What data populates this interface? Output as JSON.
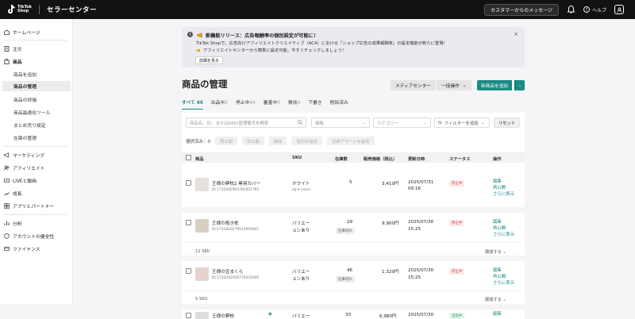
{
  "topbar": {
    "logo_line1": "TikTok",
    "logo_line2": "Shop",
    "title": "セラーセンター",
    "message_button": "カスタマーからのメッセージ",
    "help_label": "ヘルプ"
  },
  "sidebar": {
    "home": "ホームページ",
    "orders": "注文",
    "products": "商品",
    "products_sub": [
      "商品を追加",
      "商品の管理",
      "商品の評価",
      "商品最適化ツール",
      "まとめ売り設定",
      "在庫の管理"
    ],
    "marketing": "マーケティング",
    "affiliate": "アフィリエイト",
    "live": "LIVEと動画",
    "growth": "成長",
    "apps": "アプリとパートナー",
    "analytics": "分析",
    "account_health": "アカウントの健全性",
    "finance": "ファイナンス"
  },
  "banner": {
    "title": "新機能リリース：広告報酬率の個別設定が可能に！",
    "line1": "TikTok Shopで、広告向けアフィリエイトクリエイティブ（ACA）における「ショップ広告の成果報酬率」の設定機能が新たに登場！",
    "line2": "アフィリエイトセンターから簡単に設定可能。今すぐチェックしましょう！",
    "button": "詳細を見る",
    "close": "×"
  },
  "page": {
    "title": "商品の管理",
    "media_center": "メディアセンター",
    "bulk_action": "一括操作",
    "add_product": "新商品を追加"
  },
  "tabs": [
    {
      "label": "すべて",
      "count": "46"
    },
    {
      "label": "出品中",
      "count": "2"
    },
    {
      "label": "停止中",
      "count": "44"
    },
    {
      "label": "審査中",
      "count": "0"
    },
    {
      "label": "無効",
      "count": "0"
    },
    {
      "label": "下書き",
      "count": ""
    },
    {
      "label": "削除済み",
      "count": ""
    }
  ],
  "filters": {
    "search_placeholder": "商品名、ID、またはSKU/管理番号を検索",
    "price": "価格",
    "category": "カテゴリー",
    "add_filter": "フィルターを追加",
    "reset": "リセット"
  },
  "actions": {
    "selected": "選択済み：",
    "selected_count": "0",
    "buttons": [
      "再公開",
      "非公開",
      "削除",
      "割引を設定",
      "在庫アラートを設定"
    ]
  },
  "table": {
    "headers": [
      "商品",
      "SKU",
      "在庫数",
      "販売価格（税込）",
      "更新日時",
      "ステータス",
      "操作"
    ],
    "rows": [
      {
        "name": "王様の夢枕2 専用カバー",
        "id": "ID:1732042903782851765",
        "sku": "ホワイト",
        "sku_sub": "op-k-cover",
        "stock": "5",
        "stock_tag": "",
        "price": "3,410円",
        "date": "2025/07/31",
        "time": "09:16",
        "status": "停止中",
        "ops": [
          "編集",
          "再公開",
          "さらに表示"
        ],
        "sku_count": "",
        "expand": ""
      },
      {
        "name": "王様の抱き枕",
        "id": "ID:1731820279533992841",
        "sku": "バリエー",
        "sku2": "ョンあり",
        "stock": "29",
        "stock_tag": "在庫切れ",
        "price": "9,900円",
        "date": "2025/07/30",
        "time": "15:25",
        "status": "停止中",
        "ops": [
          "編集",
          "再公開",
          "さらに表示"
        ],
        "sku_count": "12 SKU",
        "expand": "展開する"
      },
      {
        "name": "王様の豆まくら",
        "id": "ID:1732042929770431609",
        "sku": "バリエー",
        "sku2": "ョンあり",
        "stock": "46",
        "stock_tag": "在庫切れ",
        "price": "1,320円",
        "date": "2025/07/30",
        "time": "15:25",
        "status": "停止中",
        "ops": [
          "編集",
          "再公開",
          "さらに表示"
        ],
        "sku_count": "5 SKU",
        "expand": "展開する"
      },
      {
        "name": "王様の夢枕",
        "sku": "バリエー",
        "stock": "33",
        "price": "6,980円",
        "date": "2025/07/30",
        "status": "出品中",
        "ops": [
          "編集"
        ]
      }
    ]
  },
  "colors": {
    "accent": "#1a8c83",
    "topbar": "#121212",
    "status_stopped": "#d23c3c",
    "status_live": "#1f9d5a"
  }
}
